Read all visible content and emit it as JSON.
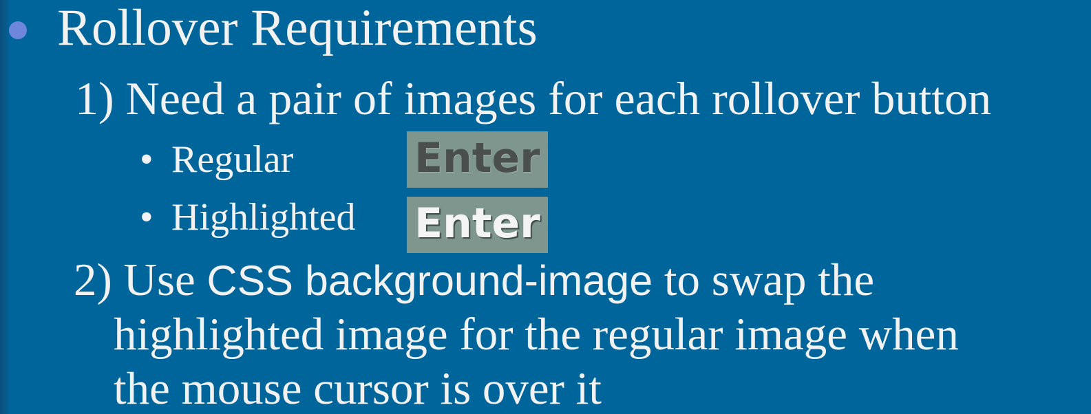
{
  "slide": {
    "background_color": "#00659b",
    "bullet_color": "#6e86dc",
    "title": "Rollover Requirements",
    "item1": "1) Need a pair of images for each rollover button",
    "sub_bullet_char": "•",
    "sub_items": [
      {
        "label": "Regular",
        "button_text": "Enter",
        "state": "regular"
      },
      {
        "label": "Highlighted",
        "button_text": "Enter",
        "state": "highlighted"
      }
    ],
    "item2": {
      "prefix": "2) Use ",
      "code": "CSS background-image",
      "suffix": " to swap the",
      "line2": "highlighted image for the regular image when",
      "line3": "the mouse cursor is over it"
    }
  }
}
